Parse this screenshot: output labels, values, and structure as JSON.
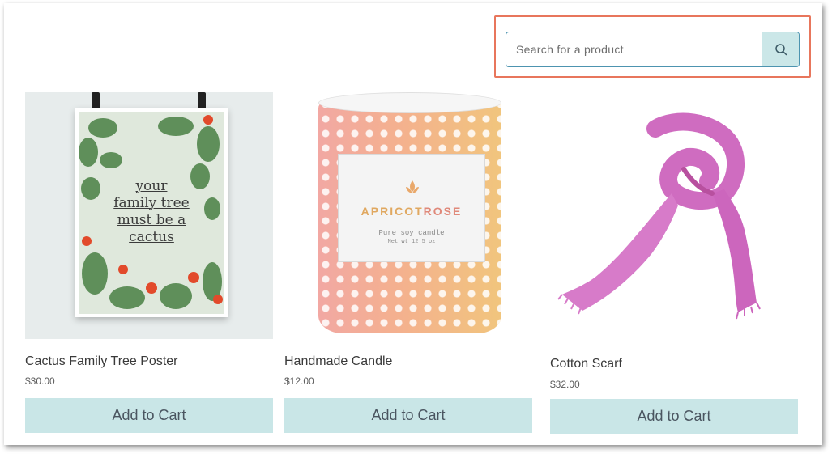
{
  "search": {
    "placeholder": "Search for a product",
    "icon": "search-icon"
  },
  "highlight_color": "#e8765c",
  "accent_color": "#c9e6e7",
  "products": [
    {
      "name": "Cactus Family Tree Poster",
      "price": "$30.00",
      "button": "Add to Cart",
      "image_text": [
        "your",
        "family tree",
        "must be a",
        "cactus"
      ]
    },
    {
      "name": "Handmade Candle",
      "price": "$12.00",
      "button": "Add to Cart",
      "label_brand_a": "APRICOT",
      "label_brand_b": "ROSE",
      "label_line1": "Pure soy candle",
      "label_line2": "Net wt 12.5 oz"
    },
    {
      "name": "Cotton Scarf",
      "price": "$32.00",
      "button": "Add to Cart"
    }
  ]
}
